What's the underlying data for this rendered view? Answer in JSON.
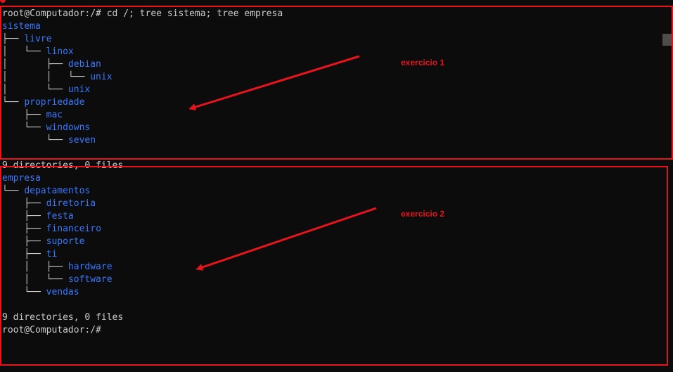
{
  "terminal": {
    "lines": [
      [
        {
          "text": "root@Computador:/# cd /; tree sistema; tree empresa",
          "kind": "text"
        }
      ],
      [
        {
          "text": "sistema",
          "kind": "dir"
        }
      ],
      [
        {
          "text": "├── ",
          "kind": "glyph"
        },
        {
          "text": "livre",
          "kind": "dir"
        }
      ],
      [
        {
          "text": "│   └── ",
          "kind": "glyph"
        },
        {
          "text": "linox",
          "kind": "dir"
        }
      ],
      [
        {
          "text": "│       ├── ",
          "kind": "glyph"
        },
        {
          "text": "debian",
          "kind": "dir"
        }
      ],
      [
        {
          "text": "│       │   └── ",
          "kind": "glyph"
        },
        {
          "text": "unix",
          "kind": "dir"
        }
      ],
      [
        {
          "text": "│       └── ",
          "kind": "glyph"
        },
        {
          "text": "unix",
          "kind": "dir"
        }
      ],
      [
        {
          "text": "└── ",
          "kind": "glyph"
        },
        {
          "text": "propriedade",
          "kind": "dir"
        }
      ],
      [
        {
          "text": "    ├── ",
          "kind": "glyph"
        },
        {
          "text": "mac",
          "kind": "dir"
        }
      ],
      [
        {
          "text": "    └── ",
          "kind": "glyph"
        },
        {
          "text": "windowns",
          "kind": "dir"
        }
      ],
      [
        {
          "text": "        └── ",
          "kind": "glyph"
        },
        {
          "text": "seven",
          "kind": "dir"
        }
      ],
      [
        {
          "text": "",
          "kind": "text"
        }
      ],
      [
        {
          "text": "9 directories, 0 files",
          "kind": "text"
        }
      ],
      [
        {
          "text": "empresa",
          "kind": "dir"
        }
      ],
      [
        {
          "text": "└── ",
          "kind": "glyph"
        },
        {
          "text": "depatamentos",
          "kind": "dir"
        }
      ],
      [
        {
          "text": "    ├── ",
          "kind": "glyph"
        },
        {
          "text": "diretoria",
          "kind": "dir"
        }
      ],
      [
        {
          "text": "    ├── ",
          "kind": "glyph"
        },
        {
          "text": "festa",
          "kind": "dir"
        }
      ],
      [
        {
          "text": "    ├── ",
          "kind": "glyph"
        },
        {
          "text": "financeiro",
          "kind": "dir"
        }
      ],
      [
        {
          "text": "    ├── ",
          "kind": "glyph"
        },
        {
          "text": "suporte",
          "kind": "dir"
        }
      ],
      [
        {
          "text": "    ├── ",
          "kind": "glyph"
        },
        {
          "text": "ti",
          "kind": "dir"
        }
      ],
      [
        {
          "text": "    │   ├── ",
          "kind": "glyph"
        },
        {
          "text": "hardware",
          "kind": "dir"
        }
      ],
      [
        {
          "text": "    │   └── ",
          "kind": "glyph"
        },
        {
          "text": "software",
          "kind": "dir"
        }
      ],
      [
        {
          "text": "    └── ",
          "kind": "glyph"
        },
        {
          "text": "vendas",
          "kind": "dir"
        }
      ],
      [
        {
          "text": "",
          "kind": "text"
        }
      ],
      [
        {
          "text": "9 directories, 0 files",
          "kind": "text"
        }
      ],
      [
        {
          "text": "root@Computador:/#",
          "kind": "text"
        }
      ]
    ]
  },
  "annotations": {
    "exercise1_label": "exercicio 1",
    "exercise2_label": "exercicio 2",
    "color": "#e8141b"
  },
  "colors": {
    "background": "#0c0c0c",
    "text": "#cccccc",
    "directory": "#3b78ff"
  }
}
